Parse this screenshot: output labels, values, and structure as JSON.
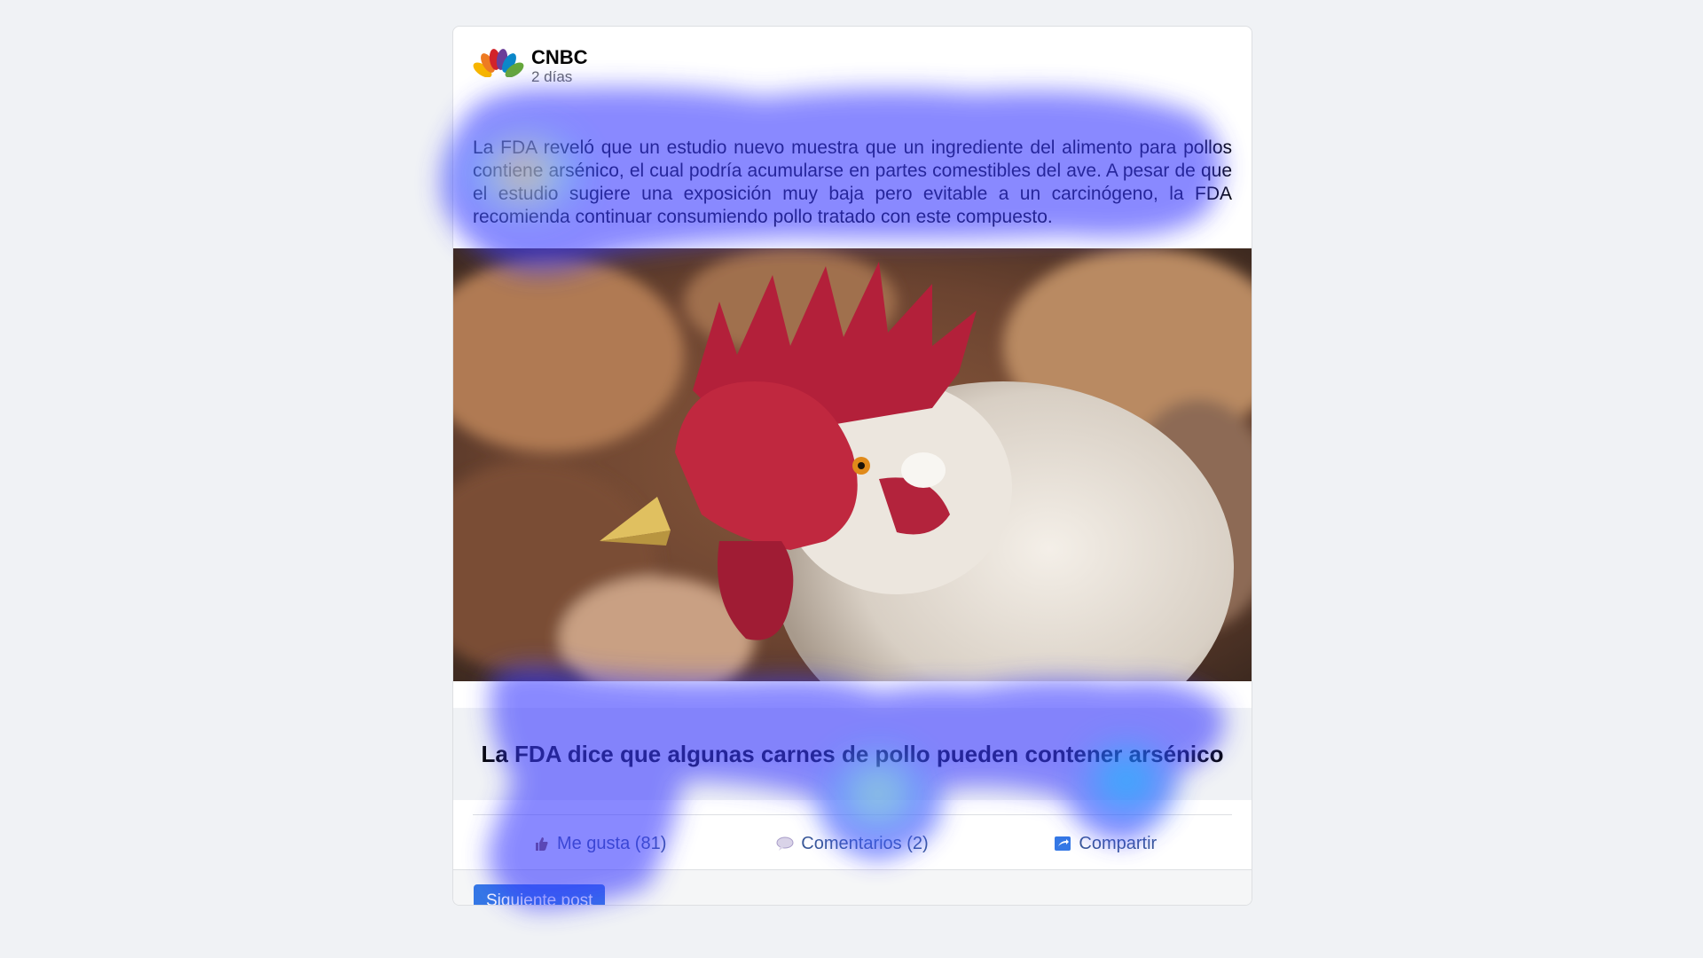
{
  "post": {
    "source": "CNBC",
    "time": "2 días",
    "text": "La FDA reveló que un estudio nuevo muestra que un ingrediente del alimento para pollos contiene arsénico, el cual podría acumularse en partes comestibles del ave. A pesar de que el estudio sugiere una exposición muy baja pero evitable a un carcinógeno, la FDA recomienda continuar consumiendo pollo tratado con este compuesto.",
    "headline": "La FDA dice que algunas carnes de pollo pueden contener arsénico",
    "image_icon": "rooster-photo"
  },
  "actions": {
    "like_label": "Me gusta (81)",
    "like_icon": "thumbs-up-icon",
    "comment_label": "Comentarios (2)",
    "comment_icon": "speech-bubble-icon",
    "share_label": "Compartir",
    "share_icon": "share-icon"
  },
  "footer": {
    "next_label": "Siguiente post"
  },
  "colors": {
    "background": "#f0f2f5",
    "card": "#ffffff",
    "link": "#3b5998",
    "button": "#3578e5"
  }
}
